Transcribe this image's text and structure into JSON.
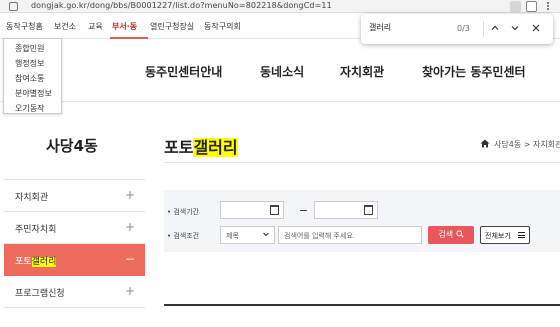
{
  "browser": {
    "url": "dongjak.go.kr/dong/bbs/B0001227/list.do?menuNo=802218&dongCd=11"
  },
  "gnb": {
    "items": [
      "동작구청홈",
      "보건소",
      "교육",
      "부서·동",
      "열린구청장실",
      "동작구의회"
    ],
    "active_index": 3
  },
  "submenu": {
    "items": [
      "종합민원",
      "행정정보",
      "참여소통",
      "분야별정보",
      "오기동작"
    ]
  },
  "main_nav": {
    "items": [
      "동주민센터안내",
      "동네소식",
      "자치회관",
      "찾아가는 동주민센터"
    ]
  },
  "find_bar": {
    "query": "갤러리",
    "count": "0/3",
    "up_icon": "chevron-up-icon",
    "down_icon": "chevron-down-icon",
    "close_icon": "close-icon"
  },
  "sidebar": {
    "title": "사당4동",
    "items": [
      {
        "label": "자치회관",
        "control": "+",
        "active": false
      },
      {
        "label": "주민자치회",
        "control": "+",
        "active": false
      },
      {
        "label_prefix": "포토",
        "label_highlight": "갤러리",
        "control": "−",
        "active": true
      },
      {
        "label": "프로그램신청",
        "control": "+",
        "active": false
      }
    ]
  },
  "page": {
    "title_prefix": "포토",
    "title_highlight": "갤러리",
    "breadcrumb": "사당4동 > 자치회관"
  },
  "search": {
    "period_label": "• 검색기간",
    "condition_label": "• 검색조건",
    "select_value": "제목",
    "keyword_placeholder": "검색어를 입력해 주세요.",
    "search_button": "검색",
    "view_all_button": "전체보기"
  },
  "colors": {
    "accent": "#ed6c5c",
    "search_button": "#e9565b",
    "highlight": "#ffff00",
    "active_gnb": "#c2362b"
  }
}
